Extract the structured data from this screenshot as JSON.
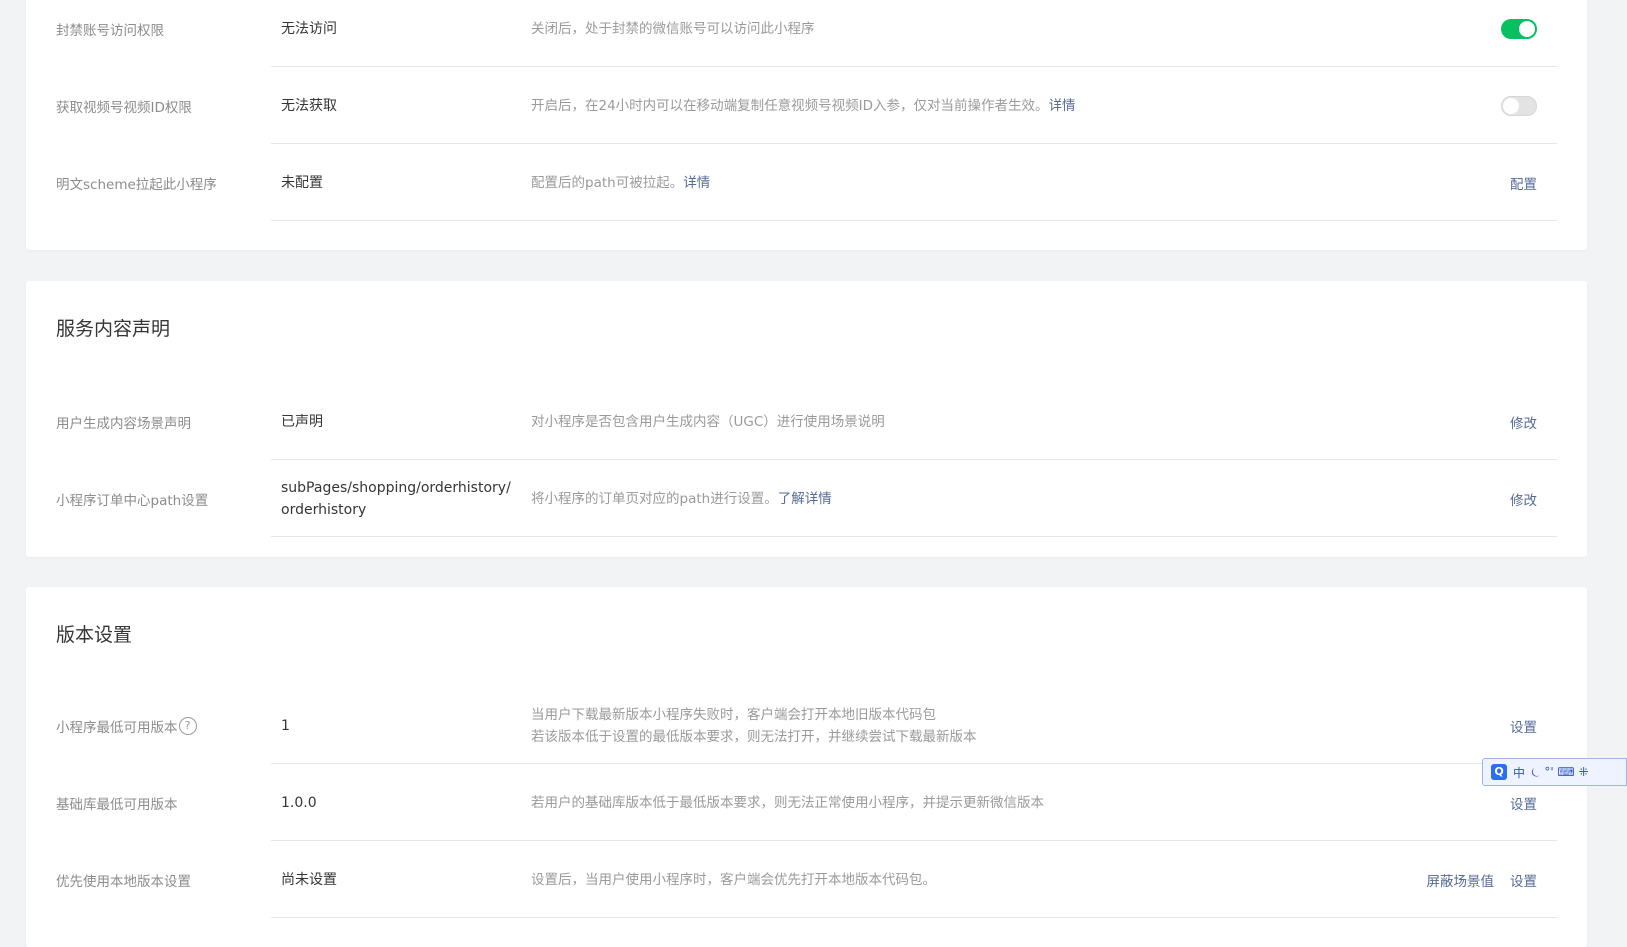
{
  "section_access": {
    "rows": [
      {
        "label": "封禁账号访问权限",
        "value": "无法访问",
        "desc": "关闭后，处于封禁的微信账号可以访问此小程序",
        "toggle": "on"
      },
      {
        "label": "获取视频号视频ID权限",
        "value": "无法获取",
        "desc": "开启后，在24小时内可以在移动端复制任意视频号视频ID入参，仅对当前操作者生效。",
        "desc_link": "详情",
        "toggle": "off"
      },
      {
        "label": "明文scheme拉起此小程序",
        "value": "未配置",
        "desc": "配置后的path可被拉起。",
        "desc_link": "详情",
        "action": "配置"
      }
    ]
  },
  "section_service": {
    "title": "服务内容声明",
    "rows": [
      {
        "label": "用户生成内容场景声明",
        "value": "已声明",
        "desc": "对小程序是否包含用户生成内容（UGC）进行使用场景说明",
        "action": "修改"
      },
      {
        "label": "小程序订单中心path设置",
        "value_line1": "subPages/shopping/orderhistory/",
        "value_line2": "orderhistory",
        "desc": "将小程序的订单页对应的path进行设置。",
        "desc_link": "了解详情",
        "action": "修改"
      }
    ]
  },
  "section_version": {
    "title": "版本设置",
    "rows": [
      {
        "label": "小程序最低可用版本",
        "help": "?",
        "value": "1",
        "desc_line1": "当用户下载最新版本小程序失败时，客户端会打开本地旧版本代码包",
        "desc_line2": "若该版本低于设置的最低版本要求，则无法打开，并继续尝试下载最新版本",
        "action": "设置"
      },
      {
        "label": "基础库最低可用版本",
        "value": "1.0.0",
        "desc": "若用户的基础库版本低于最低版本要求，则无法正常使用小程序，并提示更新微信版本",
        "action": "设置"
      },
      {
        "label": "优先使用本地版本设置",
        "value": "尚未设置",
        "desc": "设置后，当用户使用小程序时，客户端会优先打开本地版本代码包。",
        "action_secondary": "屏蔽场景值",
        "action": "设置"
      }
    ]
  },
  "ime": {
    "logo": "Q",
    "mode": "中",
    "glyphs": "⏾ °' ⌨ ⁜"
  },
  "colors": {
    "link": "#576b95",
    "toggle_on": "#07c160",
    "background": "#f2f3f5"
  }
}
